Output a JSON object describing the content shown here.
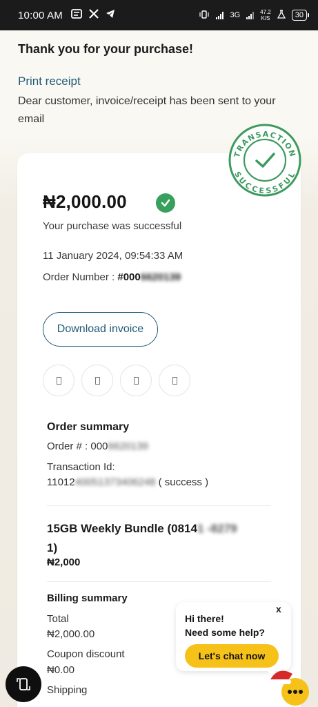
{
  "status_bar": {
    "time": "10:00 AM",
    "network": "3G",
    "speed_value": "47.2",
    "speed_unit": "K/S",
    "battery": "30"
  },
  "header": {
    "thanks": "Thank you for your purchase!",
    "print_receipt": "Print receipt",
    "note": "Dear customer, invoice/receipt has been sent to your email"
  },
  "stamp": {
    "top_text": "TRANSACTION",
    "bottom_text": "SUCCESSFUL",
    "color": "#3c9a5f"
  },
  "receipt": {
    "amount": "₦2,000.00",
    "message": "Your purchase was successful",
    "datetime": "11 January 2024, 09:54:33 AM",
    "order_label": "Order Number : ",
    "order_prefix": "#000",
    "order_masked": "6620139",
    "download_invoice": "Download invoice"
  },
  "share_buttons": [
    "share-1",
    "share-2",
    "share-3",
    "share-4"
  ],
  "order_summary": {
    "title": "Order summary",
    "order_label": "Order # : ",
    "order_prefix": "000",
    "order_masked": "6620139",
    "txn_label": "Transaction Id:",
    "txn_prefix": "11012",
    "txn_masked": "40051373406248",
    "txn_status": " ( success )"
  },
  "item": {
    "title_prefix": "15GB Weekly Bundle (0814",
    "title_masked": "1 -8279",
    "title_suffix": "1)",
    "price": "₦2,000"
  },
  "billing": {
    "title": "Billing summary",
    "total_label": "Total",
    "total_value": "₦2,000.00",
    "coupon_label": "Coupon discount",
    "coupon_value": "₦0.00",
    "shipping_label": "Shipping"
  },
  "chat": {
    "close": "x",
    "greeting": "Hi there!",
    "question": "Need some help?",
    "button": "Let's chat now",
    "accent": "#f6c21a"
  },
  "colors": {
    "link": "#1f5a78",
    "success": "#36a05c"
  }
}
